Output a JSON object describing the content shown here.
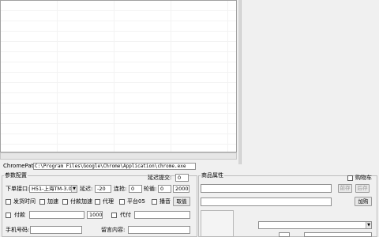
{
  "chrome_path": {
    "label": "ChromePath:",
    "value": "C:\\Program Files\\Google\\Chrome\\Application\\chrome.exe"
  },
  "params": {
    "group_title": "参数配置",
    "delay_submit_label": "延迟提交:",
    "delay_submit_value": "0",
    "order_api_label": "下单接口:",
    "order_api_value": "H51-上海TM-3.0",
    "delay_label": "延迟:",
    "delay_value": "-20",
    "consecutive_label": "连抢:",
    "consecutive_value": "0",
    "rounds_label": "轮循:",
    "rounds_value": "0",
    "rounds_extra_value": "2000",
    "send_time_label": "发货时间",
    "accelerate_label": "加速",
    "pay_accelerate_label": "付款加速",
    "proxy_label": "代理",
    "platform_label": "平台05",
    "broadcast_label": "播音",
    "take_value_button": "取值",
    "pay_label": "付款",
    "pay_amount_value": "1000",
    "pay_for_label": "代付",
    "phone_label": "手机号码:",
    "message_label": "留言内容:"
  },
  "product": {
    "group_title": "商品属性",
    "cart_label": "购物车",
    "prev_button": "前存",
    "next_button": "后存",
    "add_button": "加购"
  }
}
